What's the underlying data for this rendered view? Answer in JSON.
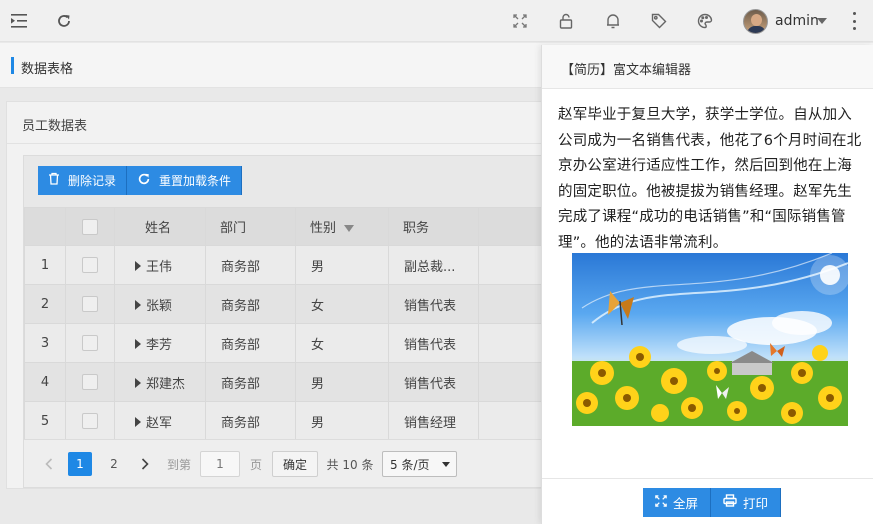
{
  "header": {
    "user_name": "admin",
    "icons": [
      "menu-fold-icon",
      "refresh-icon",
      "fullscreen-icon",
      "lock-icon",
      "bell-icon",
      "tag-icon",
      "palette-icon",
      "more-vertical-icon"
    ]
  },
  "breadcrumb": {
    "title": "数据表格"
  },
  "panel": {
    "title": "员工数据表",
    "toolbar": {
      "delete_label": "删除记录",
      "reload_label": "重置加载条件"
    },
    "columns": [
      "姓名",
      "部门",
      "性别",
      "职务"
    ],
    "rows": [
      {
        "index": "1",
        "name": "王伟",
        "dept": "商务部",
        "sex": "男",
        "job": "副总裁..."
      },
      {
        "index": "2",
        "name": "张颖",
        "dept": "商务部",
        "sex": "女",
        "job": "销售代表"
      },
      {
        "index": "3",
        "name": "李芳",
        "dept": "商务部",
        "sex": "女",
        "job": "销售代表"
      },
      {
        "index": "4",
        "name": "郑建杰",
        "dept": "商务部",
        "sex": "男",
        "job": "销售代表"
      },
      {
        "index": "5",
        "name": "赵军",
        "dept": "商务部",
        "sex": "男",
        "job": "销售经理"
      }
    ],
    "pager": {
      "page1": "1",
      "page2": "2",
      "goto_label": "到第",
      "page_value": "1",
      "page_unit": "页",
      "confirm_label": "确定",
      "total_label": "共 10 条",
      "size_label": "5 条/页"
    }
  },
  "drawer": {
    "title": "【简历】富文本编辑器",
    "body": "赵军毕业于复旦大学，获学士学位。自从加入公司成为一名销售代表，他花了6个月时间在北京办公室进行适应性工作，然后回到他在上海的固定职位。他被提拔为销售经理。赵军先生完成了课程“成功的电话销售”和“国际销售管理”。他的法语非常流利。",
    "fullscreen_label": "全屏",
    "print_label": "打印"
  },
  "colors": {
    "accent": "#1e88e5",
    "button": "#2d8be3"
  }
}
